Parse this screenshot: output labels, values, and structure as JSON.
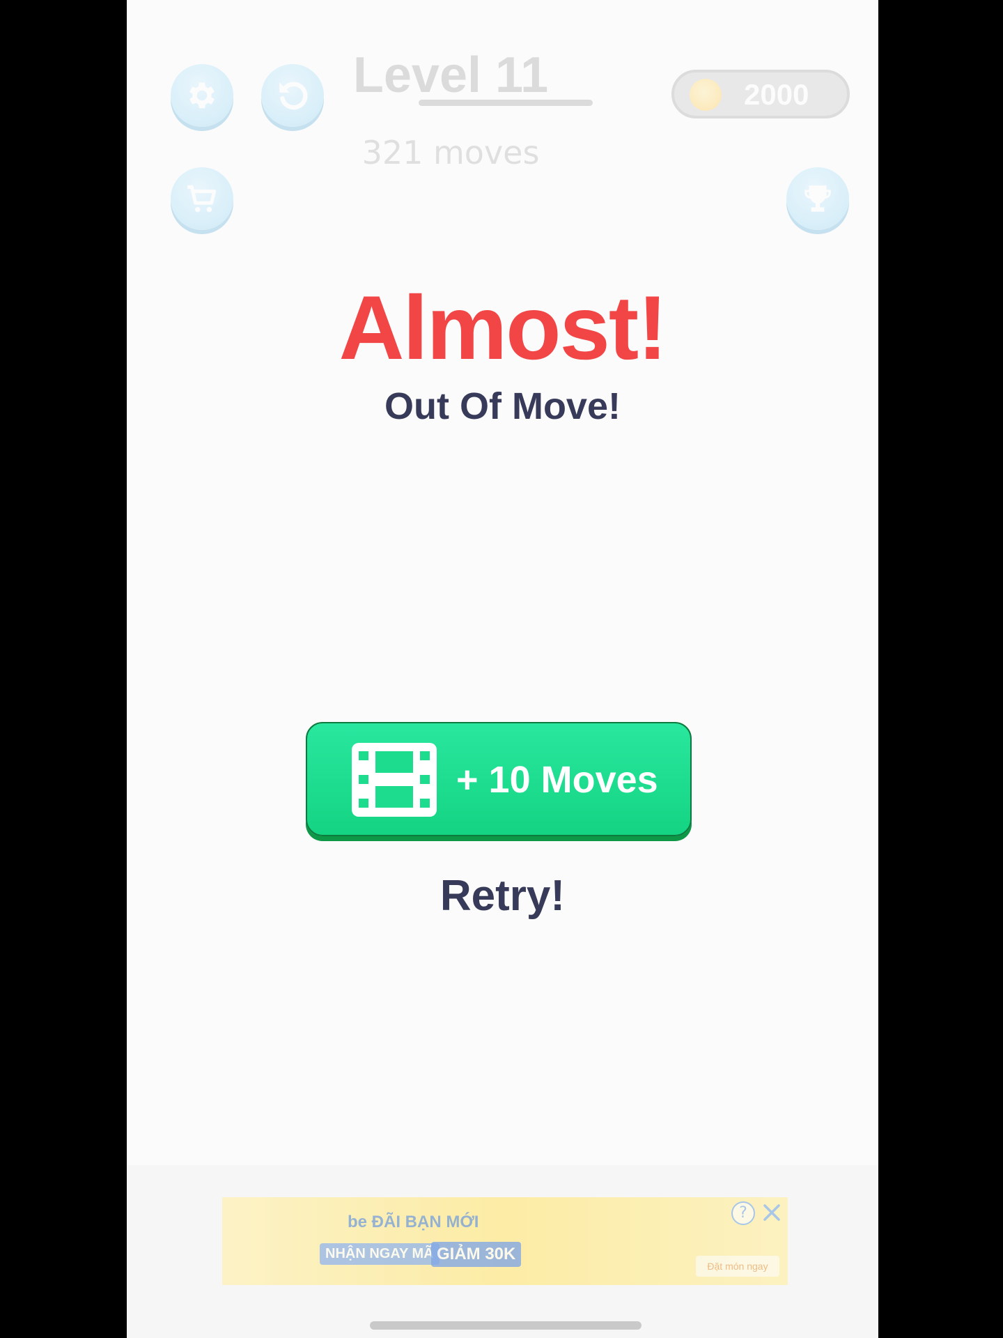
{
  "hud": {
    "level_title": "Level 11",
    "moves_count": "321 moves",
    "coins": "2000",
    "buttons": {
      "settings_icon": "gear-icon",
      "restart_icon": "restart-icon",
      "shop_icon": "cart-icon",
      "leaderboard_icon": "trophy-icon"
    }
  },
  "dialog": {
    "title": "Almost!",
    "subtitle": "Out Of Move!",
    "extra_moves_label": "+ 10 Moves",
    "extra_moves_icon": "video-ad-icon",
    "retry_label": "Retry!"
  },
  "ad": {
    "line1": "be ĐÃI BẠN MỚI",
    "line2": "NHẬN NGAY MÃ",
    "line3": "GIẢM 30K",
    "cta": "Đặt món ngay"
  },
  "colors": {
    "title": "#f24646",
    "text_dark": "#383a59",
    "button_green": "#1ddc8e"
  }
}
